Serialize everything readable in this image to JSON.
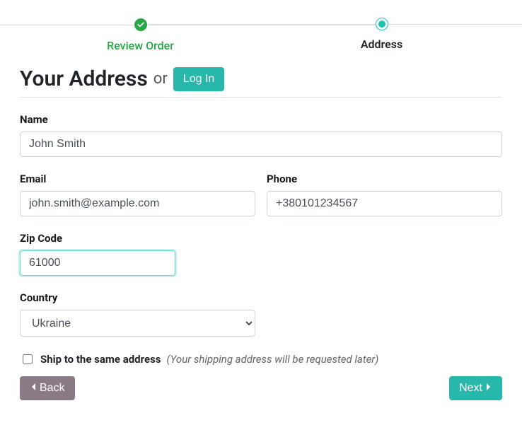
{
  "stepper": {
    "step1": {
      "label": "Review Order"
    },
    "step2": {
      "label": "Address"
    }
  },
  "heading": {
    "title": "Your Address",
    "or": "or",
    "login_btn": "Log In"
  },
  "form": {
    "name": {
      "label": "Name",
      "value": "John Smith"
    },
    "email": {
      "label": "Email",
      "value": "john.smith@example.com"
    },
    "phone": {
      "label": "Phone",
      "value": "+380101234567"
    },
    "zip": {
      "label": "Zip Code",
      "value": "61000"
    },
    "country": {
      "label": "Country",
      "value": "Ukraine"
    },
    "ship_same": {
      "label": "Ship to the same address",
      "note": "(Your shipping address will be requested later)"
    }
  },
  "buttons": {
    "back": "Back",
    "next": "Next"
  }
}
